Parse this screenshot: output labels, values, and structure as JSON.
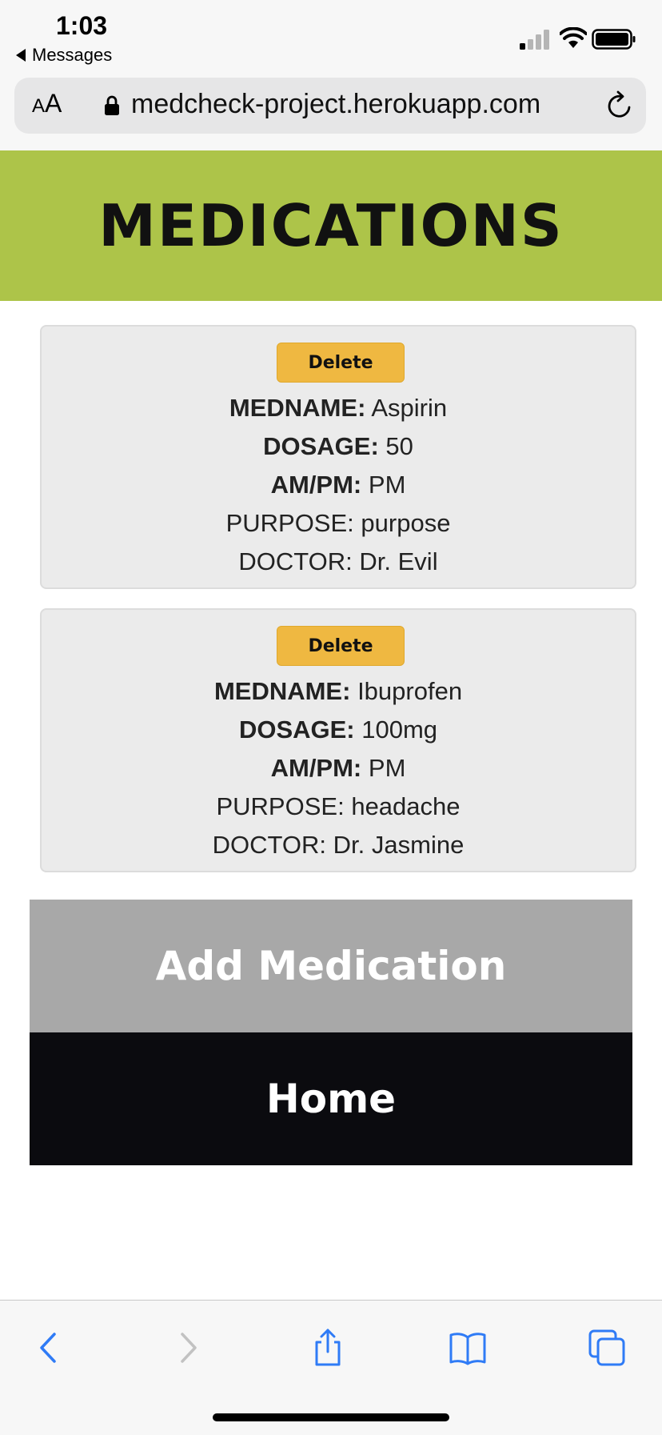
{
  "status_bar": {
    "time": "1:03",
    "back_label": "Messages"
  },
  "browser": {
    "aa_small": "A",
    "aa_large": "A",
    "url": "medcheck-project.herokuapp.com"
  },
  "page": {
    "title": "MEDICATIONS"
  },
  "medications": [
    {
      "delete_label": "Delete",
      "medname_label": "MEDNAME:",
      "medname": "Aspirin",
      "dosage_label": "DOSAGE:",
      "dosage": "50",
      "ampm_label": "AM/PM:",
      "ampm": "PM",
      "purpose_label": "PURPOSE:",
      "purpose": "purpose",
      "doctor_label": "DOCTOR:",
      "doctor": "Dr. Evil"
    },
    {
      "delete_label": "Delete",
      "medname_label": "MEDNAME:",
      "medname": "Ibuprofen",
      "dosage_label": "DOSAGE:",
      "dosage": "100mg",
      "ampm_label": "AM/PM:",
      "ampm": "PM",
      "purpose_label": "PURPOSE:",
      "purpose": "headache",
      "doctor_label": "DOCTOR:",
      "doctor": "Dr. Jasmine"
    }
  ],
  "actions": {
    "add_label": "Add Medication",
    "home_label": "Home"
  },
  "colors": {
    "header_bg": "#adc449",
    "delete_bg": "#efb841",
    "add_bg": "#a8a8a8",
    "home_bg": "#0b0b0f",
    "ios_blue": "#2f7bf6"
  },
  "toolbar_icons": [
    "back-icon",
    "forward-icon",
    "share-icon",
    "bookmarks-icon",
    "tabs-icon"
  ]
}
